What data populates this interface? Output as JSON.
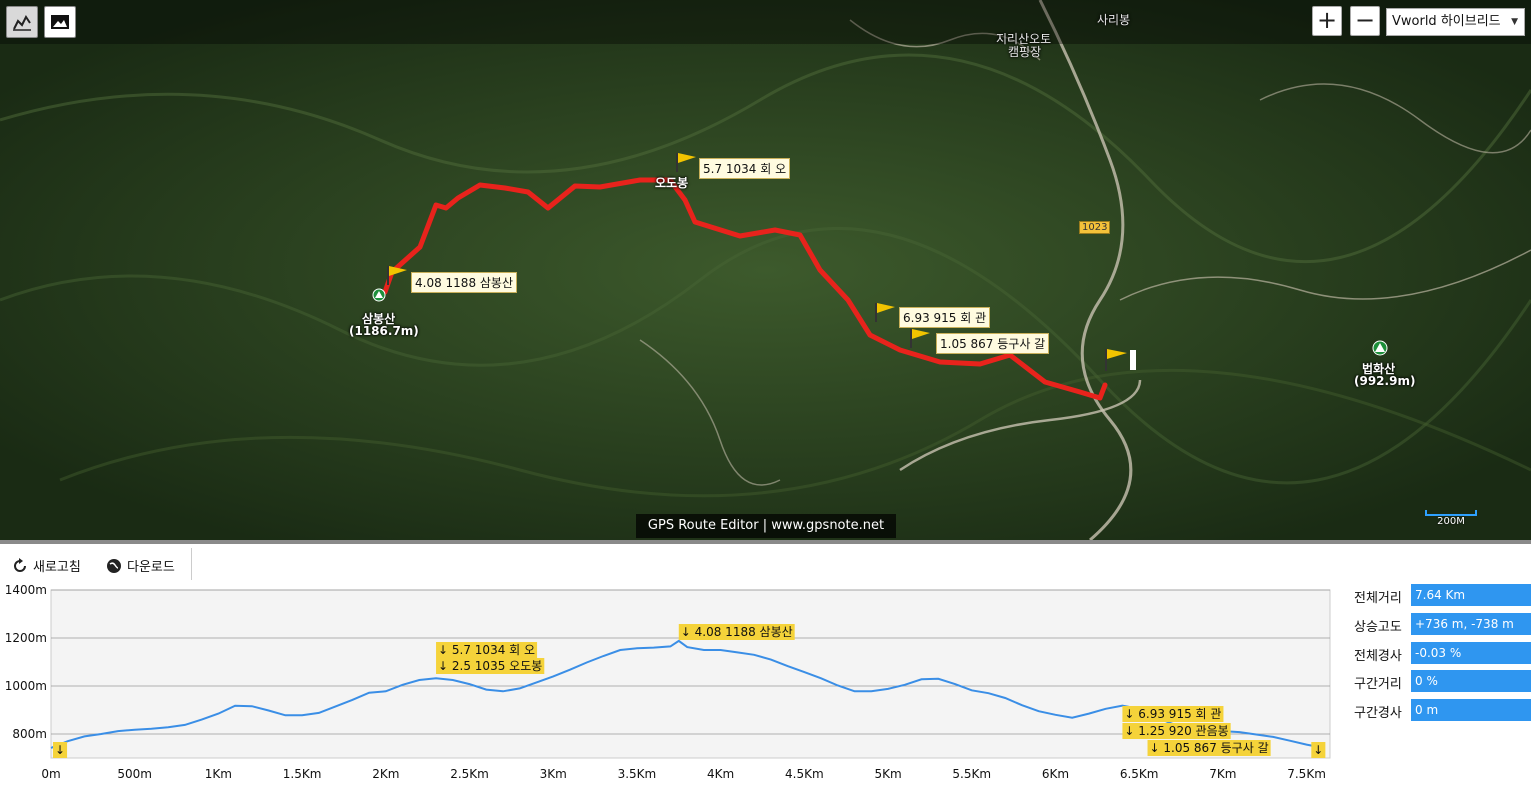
{
  "toolbar": {
    "chart_icon": "line-chart-icon",
    "image_icon": "image-icon"
  },
  "map": {
    "zoom_in": "+",
    "zoom_out": "−",
    "layer": "Vworld 하이브리드",
    "places": {
      "saribong": "사리봉",
      "camping": "지리산오토",
      "camping2": "캠핑장",
      "sambongsan": "삼봉산",
      "sambongsan_h": "(1186.7m)",
      "beophwasan": "법화산",
      "beophwasan_h": "(992.9m)",
      "odobong": "오도봉"
    },
    "road_number": "1023",
    "flags": {
      "flag1": "5.7 1034 회 오",
      "flag2": "4.08 1188 삼봉산",
      "flag3": "6.93 915 회 관",
      "flag4": "1.05 867 등구사 갈"
    },
    "watermark": "GPS Route Editor | www.gpsnote.net",
    "scale": "200M"
  },
  "chart_toolbar": {
    "refresh": "새로고침",
    "download": "다운로드"
  },
  "chart_data": {
    "type": "area",
    "xlabel": "",
    "ylabel": "",
    "xlim": [
      0,
      7.64
    ],
    "ylim": [
      700,
      1400
    ],
    "xticks": [
      "0m",
      "500m",
      "1Km",
      "1.5Km",
      "2Km",
      "2.5Km",
      "3Km",
      "3.5Km",
      "4Km",
      "4.5Km",
      "5Km",
      "5.5Km",
      "6Km",
      "6.5Km",
      "7Km",
      "7.5Km"
    ],
    "xtick_values": [
      0,
      0.5,
      1,
      1.5,
      2,
      2.5,
      3,
      3.5,
      4,
      4.5,
      5,
      5.5,
      6,
      6.5,
      7,
      7.5
    ],
    "yticks": [
      "800m",
      "1000m",
      "1200m",
      "1400m"
    ],
    "ytick_values": [
      800,
      1000,
      1200,
      1400
    ],
    "x": [
      0,
      0.1,
      0.2,
      0.3,
      0.4,
      0.5,
      0.6,
      0.7,
      0.8,
      0.9,
      1.0,
      1.1,
      1.2,
      1.3,
      1.4,
      1.5,
      1.6,
      1.7,
      1.8,
      1.9,
      2.0,
      2.1,
      2.2,
      2.3,
      2.4,
      2.5,
      2.6,
      2.7,
      2.8,
      2.9,
      3.0,
      3.1,
      3.2,
      3.3,
      3.4,
      3.5,
      3.6,
      3.7,
      3.75,
      3.8,
      3.9,
      4.0,
      4.1,
      4.2,
      4.3,
      4.4,
      4.5,
      4.6,
      4.7,
      4.8,
      4.9,
      5.0,
      5.1,
      5.2,
      5.3,
      5.4,
      5.5,
      5.6,
      5.7,
      5.8,
      5.9,
      6.0,
      6.1,
      6.2,
      6.3,
      6.4,
      6.5,
      6.6,
      6.7,
      6.8,
      6.9,
      7.0,
      7.1,
      7.2,
      7.3,
      7.4,
      7.5,
      7.6
    ],
    "values": [
      742,
      770,
      790,
      800,
      812,
      818,
      822,
      828,
      838,
      860,
      885,
      918,
      916,
      898,
      878,
      878,
      888,
      915,
      942,
      972,
      978,
      1005,
      1025,
      1032,
      1025,
      1008,
      985,
      978,
      990,
      1015,
      1040,
      1068,
      1098,
      1125,
      1150,
      1157,
      1160,
      1165,
      1188,
      1162,
      1150,
      1150,
      1140,
      1130,
      1110,
      1083,
      1058,
      1032,
      1002,
      978,
      978,
      988,
      1005,
      1028,
      1030,
      1008,
      982,
      970,
      950,
      920,
      895,
      880,
      868,
      885,
      905,
      918,
      905,
      870,
      842,
      828,
      820,
      812,
      808,
      798,
      788,
      772,
      756,
      742
    ],
    "line_color": "#3a8ee6",
    "annotations": [
      {
        "x": 0.02,
        "text": "↓",
        "align": "bottom"
      },
      {
        "x": 2.3,
        "text": "↓  5.7 1034 회 오"
      },
      {
        "x": 2.3,
        "text": "↓  2.5 1035 오도봉"
      },
      {
        "x": 3.75,
        "text": "↓  4.08 1188 삼봉산"
      },
      {
        "x": 6.4,
        "text": "↓  6.93 915 회 관"
      },
      {
        "x": 6.4,
        "text": "↓  1.25 920 관음봉"
      },
      {
        "x": 6.55,
        "text": "↓  1.05 867 등구사 갈"
      },
      {
        "x": 7.6,
        "text": "↓",
        "align": "bottom"
      }
    ]
  },
  "stats": [
    {
      "label": "전체거리",
      "value": "7.64 Km"
    },
    {
      "label": "상승고도",
      "value": "+736 m, -738 m"
    },
    {
      "label": "전체경사",
      "value": "-0.03 %"
    },
    {
      "label": "구간거리",
      "value": "0 %"
    },
    {
      "label": "구간경사",
      "value": "0 m"
    }
  ],
  "colors": {
    "route": "#e8231c",
    "accent": "#2f96f0",
    "annotation": "#f5d33a"
  }
}
